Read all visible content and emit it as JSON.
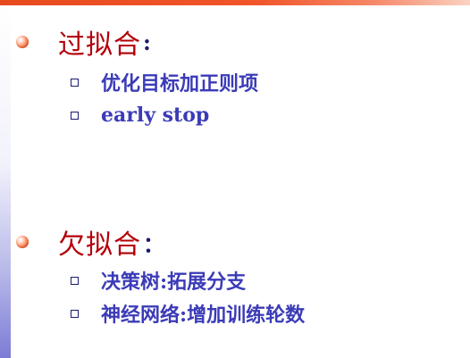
{
  "sections": [
    {
      "title": "过拟合",
      "colon": ":",
      "items": [
        "优化目标加正则项",
        "early stop"
      ]
    },
    {
      "title": "欠拟合",
      "colon": "：",
      "items": [
        "决策树:拓展分支",
        "神经网络:增加训练轮数"
      ]
    }
  ],
  "colors": {
    "heading": "#b3000b",
    "item_text": "#3b3bb8",
    "bullet_square": "#1a1a70",
    "bullet_circle": "#e23b0a",
    "top_bar": "#f0562a",
    "left_bar": "#7c7cd6"
  }
}
